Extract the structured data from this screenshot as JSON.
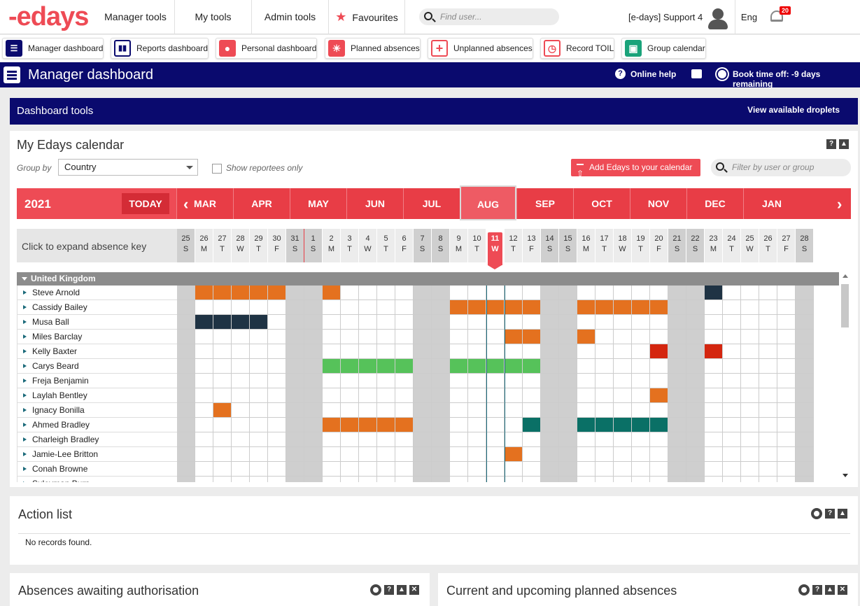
{
  "top_nav": {
    "logo": "-edays",
    "items": [
      {
        "label": "Manager tools"
      },
      {
        "label": "My tools"
      },
      {
        "label": "Admin tools"
      },
      {
        "label": "Favourites"
      }
    ],
    "search_placeholder": "Find user...",
    "user_label": "[e-days] Support 4",
    "language": "Eng",
    "notification_count": "20"
  },
  "dashboards": [
    {
      "label": "Manager dashboard",
      "color": "#0a0a6e",
      "icon": "list-icon"
    },
    {
      "label": "Reports dashboard",
      "color": "#0a0a6e",
      "icon": "bar-chart-icon"
    },
    {
      "label": "Personal dashboard",
      "color": "#ee4b55",
      "icon": "person-icon"
    },
    {
      "label": "Planned absences",
      "color": "#ee4b55",
      "icon": "sun-icon"
    },
    {
      "label": "Unplanned absences",
      "color": "#ee4b55",
      "icon": "medical-cross-icon"
    },
    {
      "label": "Record TOIL",
      "color": "#ee4b55",
      "icon": "clock-icon"
    },
    {
      "label": "Group calendar",
      "color": "#1aa37a",
      "icon": "calendar-icon"
    }
  ],
  "title_bar": {
    "title": "Manager dashboard",
    "help_label": "Online help",
    "book_prefix": "Book time off: ",
    "book_value": "-9 days",
    "book_suffix": " remaining"
  },
  "dashboard_tools": {
    "label": "Dashboard tools",
    "droplets_label": "View available droplets"
  },
  "calendar": {
    "title": "My Edays calendar",
    "group_by_label": "Group by",
    "group_by_value": "Country",
    "show_reportees_label": "Show reportees only",
    "add_button": "Add Edays to your calendar",
    "filter_placeholder": "Filter by user or group",
    "year": "2021",
    "today_label": "TODAY",
    "prev_arrow": "‹",
    "next_arrow": "›",
    "months": [
      "MAR",
      "APR",
      "MAY",
      "JUN",
      "JUL",
      "AUG",
      "SEP",
      "OCT",
      "NOV",
      "DEC",
      "JAN"
    ],
    "selected_month": "AUG",
    "expand_key_label": "Click to expand absence key",
    "days": [
      {
        "n": "25",
        "w": "S",
        "we": true
      },
      {
        "n": "26",
        "w": "M",
        "we": false
      },
      {
        "n": "27",
        "w": "T",
        "we": false
      },
      {
        "n": "28",
        "w": "W",
        "we": false
      },
      {
        "n": "29",
        "w": "T",
        "we": false
      },
      {
        "n": "30",
        "w": "F",
        "we": false
      },
      {
        "n": "31",
        "w": "S",
        "we": true
      },
      {
        "n": "1",
        "w": "S",
        "we": true
      },
      {
        "n": "2",
        "w": "M",
        "we": false
      },
      {
        "n": "3",
        "w": "T",
        "we": false
      },
      {
        "n": "4",
        "w": "W",
        "we": false
      },
      {
        "n": "5",
        "w": "T",
        "we": false
      },
      {
        "n": "6",
        "w": "F",
        "we": false
      },
      {
        "n": "7",
        "w": "S",
        "we": true
      },
      {
        "n": "8",
        "w": "S",
        "we": true
      },
      {
        "n": "9",
        "w": "M",
        "we": false
      },
      {
        "n": "10",
        "w": "T",
        "we": false
      },
      {
        "n": "11",
        "w": "W",
        "we": false,
        "today": true
      },
      {
        "n": "12",
        "w": "T",
        "we": false
      },
      {
        "n": "13",
        "w": "F",
        "we": false
      },
      {
        "n": "14",
        "w": "S",
        "we": true
      },
      {
        "n": "15",
        "w": "S",
        "we": true
      },
      {
        "n": "16",
        "w": "M",
        "we": false
      },
      {
        "n": "17",
        "w": "T",
        "we": false
      },
      {
        "n": "18",
        "w": "W",
        "we": false
      },
      {
        "n": "19",
        "w": "T",
        "we": false
      },
      {
        "n": "20",
        "w": "F",
        "we": false
      },
      {
        "n": "21",
        "w": "S",
        "we": true
      },
      {
        "n": "22",
        "w": "S",
        "we": true
      },
      {
        "n": "23",
        "w": "M",
        "we": false
      },
      {
        "n": "24",
        "w": "T",
        "we": false
      },
      {
        "n": "25",
        "w": "W",
        "we": false
      },
      {
        "n": "26",
        "w": "T",
        "we": false
      },
      {
        "n": "27",
        "w": "F",
        "we": false
      },
      {
        "n": "28",
        "w": "S",
        "we": true
      }
    ],
    "group_name": "United Kingdom",
    "absence_colors": {
      "A": "#e4711f",
      "B": "#1f3344",
      "C": "#56c25a",
      "D": "#d4260f",
      "E": "#0a7066"
    },
    "rows": [
      {
        "name": "Steve Arnold",
        "cells": ".AAAAA..A....................B....."
      },
      {
        "name": "Cassidy Bailey",
        "cells": "...............AAAAA..AAAAA........"
      },
      {
        "name": "Musa Ball",
        "cells": ".BBBB.............................."
      },
      {
        "name": "Miles Barclay",
        "cells": "..................AA..A............"
      },
      {
        "name": "Kelly Baxter",
        "cells": "..........................D..D....."
      },
      {
        "name": "Carys Beard",
        "cells": "........CCCCC..CCCCC..............."
      },
      {
        "name": "Freja Benjamin",
        "cells": "..................................."
      },
      {
        "name": "Laylah Bentley",
        "cells": "..........................A........"
      },
      {
        "name": "Ignacy Bonilla",
        "cells": "..A................................"
      },
      {
        "name": "Ahmed Bradley",
        "cells": "........AAAAA......E..EEEEE........"
      },
      {
        "name": "Charleigh Bradley",
        "cells": "..................................."
      },
      {
        "name": "Jamie-Lee Britton",
        "cells": "..................A................"
      },
      {
        "name": "Conah Browne",
        "cells": "..................................."
      },
      {
        "name": "Suleyman Burn",
        "cells": "..................................."
      }
    ]
  },
  "action_list": {
    "title": "Action list",
    "empty": "No records found."
  },
  "bottom_panels": [
    {
      "title": "Absences awaiting authorisation"
    },
    {
      "title": "Current and upcoming planned absences"
    }
  ],
  "controls": {
    "help": "?",
    "collapse": "▲",
    "close": "✕"
  }
}
